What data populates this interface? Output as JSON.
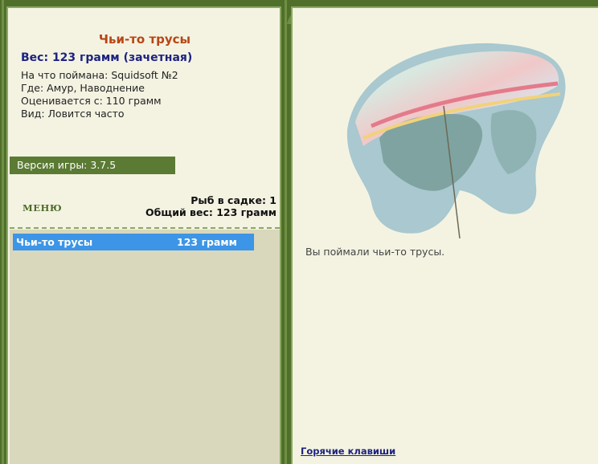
{
  "fish": {
    "name": "Чьи-то трусы",
    "weight_line": "Вес: 123 грамм (зачетная)",
    "caught_on": "На что поймана: Squidsoft №2",
    "location": "Где: Амур, Наводнение",
    "valued_from": "Оценивается с: 110 грамм",
    "kind": "Вид: Ловится часто"
  },
  "version_text": "Версия игры: 3.7.5",
  "menu_label": "МЕНЮ",
  "stats": {
    "fish_in_keepnet": "Рыб в садке: 1",
    "total_weight": "Общий вес: 123 грамм"
  },
  "keepnet": [
    {
      "name": "Чьи-то трусы",
      "weight": "123 грамм"
    }
  ],
  "caught_message": "Вы поймали чьи-то трусы.",
  "hotkeys_label": "Горячие клавиши",
  "colors": {
    "frame": "#4f6f2a",
    "panel": "#f4f3e2",
    "list_bg": "#d9d8bd",
    "selected": "#3c95e6",
    "fish_name": "#b84515",
    "weight": "#1d2380"
  }
}
